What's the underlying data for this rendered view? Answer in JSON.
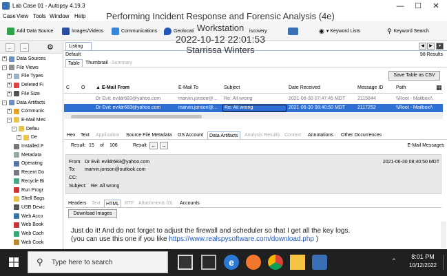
{
  "window": {
    "title": "Lab Case 01 - Autopsy 4.19.3",
    "min": "—",
    "max": "☐",
    "close": "✕"
  },
  "overlay": {
    "line1": "Performing Incident Response and Forensic Analysis (4e)",
    "line2": "Workstation",
    "line3": "2022-10-12 22:01:53",
    "line4": "Starrissa Winters"
  },
  "menu": [
    "Case",
    "View",
    "Tools",
    "Window",
    "Help"
  ],
  "toolbar": {
    "add_data_source": "Add Data Source",
    "images_videos": "Images/Videos",
    "communications": "Communications",
    "geolocation": "Geolocati",
    "discovery": "iscovery",
    "keyword_lists": "Keyword Lists",
    "keyword_search": "Keyword Search"
  },
  "tree": [
    {
      "label": "Data Sources",
      "depth": 0,
      "exp": "+",
      "icon": "#6d8fc4"
    },
    {
      "label": "File Views",
      "depth": 0,
      "exp": "-",
      "icon": "#8f8f8f"
    },
    {
      "label": "File Types",
      "depth": 1,
      "exp": "+",
      "icon": "#9db0c9"
    },
    {
      "label": "Deleted Fi",
      "depth": 1,
      "exp": "+",
      "icon": "#d44"
    },
    {
      "label": "File Size",
      "depth": 1,
      "exp": "+",
      "icon": "#555"
    },
    {
      "label": "Data Artifacts",
      "depth": 0,
      "exp": "-",
      "icon": "#6d8fc4"
    },
    {
      "label": "Communic",
      "depth": 1,
      "exp": "+",
      "icon": "#e3a32b"
    },
    {
      "label": "E-Mail Mes",
      "depth": 1,
      "exp": "-",
      "icon": "#e9c34a"
    },
    {
      "label": "Defau",
      "depth": 2,
      "exp": "-",
      "icon": "#e9c34a"
    },
    {
      "label": "De",
      "depth": 3,
      "exp": "+",
      "icon": "#e9c34a"
    },
    {
      "label": "Installed F",
      "depth": 1,
      "exp": "",
      "icon": "#777"
    },
    {
      "label": "Metadata",
      "depth": 1,
      "exp": "",
      "icon": "#9aa"
    },
    {
      "label": "Operating",
      "depth": 1,
      "exp": "",
      "icon": "#5577aa"
    },
    {
      "label": "Recent Do",
      "depth": 1,
      "exp": "",
      "icon": "#778"
    },
    {
      "label": "Recycle Bi",
      "depth": 1,
      "exp": "",
      "icon": "#4a8"
    },
    {
      "label": "Run Progr",
      "depth": 1,
      "exp": "",
      "icon": "#c33"
    },
    {
      "label": "Shell Bags",
      "depth": 1,
      "exp": "",
      "icon": "#e9c34a"
    },
    {
      "label": "USB Devic",
      "depth": 1,
      "exp": "",
      "icon": "#555"
    },
    {
      "label": "Web Acco",
      "depth": 1,
      "exp": "",
      "icon": "#37a"
    },
    {
      "label": "Web Book",
      "depth": 1,
      "exp": "",
      "icon": "#c33"
    },
    {
      "label": "Web Cach",
      "depth": 1,
      "exp": "",
      "icon": "#3a7"
    },
    {
      "label": "Web Cook",
      "depth": 1,
      "exp": "",
      "icon": "#b83"
    }
  ],
  "listing": {
    "tab": "Listing",
    "default_label": "Default",
    "results": "98 Results",
    "subtabs": [
      "Table",
      "Thumbnail",
      "Summary"
    ],
    "save_table": "Save Table as CSV",
    "columns": [
      "C",
      "O",
      "E-Mail From",
      "E-Mail To",
      "Subject",
      "Date Received",
      "Message ID",
      "Path"
    ],
    "rows": [
      [
        "",
        "",
        "Dr Evil: evildr683@yahoo.com",
        "marvin.jonson@...",
        "Re: All wrong",
        "2021-06-30 07:47:45 MDT",
        "2115844",
        "\\\\Root - Mailbox\\\\"
      ],
      [
        "",
        "",
        "Dr Evil: evildr683@yahoo.com",
        "marvin.jonson@...",
        "Re: All wrong",
        "2021-06-30 08:40:50 MDT",
        "2117252",
        "\\\\Root - Mailbox\\\\"
      ]
    ]
  },
  "content_tabs": [
    "Hex",
    "Text",
    "Application",
    "Source File Metadata",
    "OS Account",
    "Data Artifacts",
    "Analysis Results",
    "Context",
    "Annotations",
    "Other Occurrences"
  ],
  "result_bar": {
    "result_label": "Result:",
    "current": "15",
    "of": "of",
    "total": "106",
    "result_word": "Result",
    "type": "E-Mail Messages"
  },
  "email": {
    "from_label": "From:",
    "from": "Dr Evil: evildr683@yahoo.com",
    "date": "2021-06-30 08:40:50 MDT",
    "to_label": "To:",
    "to": "marvin.jonson@outlook.com",
    "cc_label": "CC:",
    "subject_label": "Subject:",
    "subject": "Re: All wrong",
    "tabs": [
      "Headers",
      "Text",
      "HTML",
      "RTF",
      "Attachments (0)",
      "Accounts"
    ],
    "download_images": "Download Images",
    "body_line1": "Just do it! And do not forget to adjust the firewall and scheduler so that I get all the key logs.",
    "body_line2_prefix": "(you can use this one if you like ",
    "body_link": "https://www.realspysoftware.com/download.php",
    "body_line2_suffix": " )"
  },
  "taskbar": {
    "search_placeholder": "Type here to search",
    "time": "8:01 PM",
    "date": "10/12/2022"
  },
  "colors": {
    "selected_row": "#2f6fd4",
    "selected_text": "#ffffff",
    "link": "#1a55c4",
    "taskbar": "#1f2021"
  }
}
